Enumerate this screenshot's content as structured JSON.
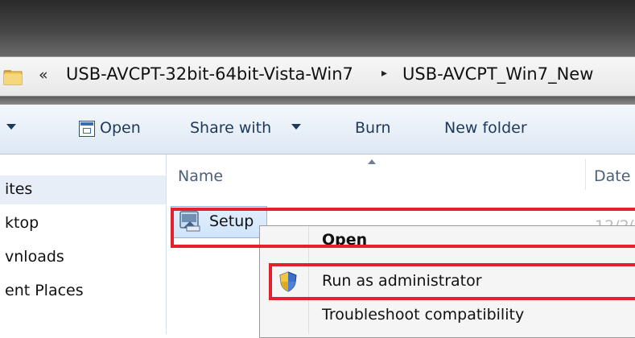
{
  "address": {
    "separator": "«",
    "crumbs": [
      "USB-AVCPT-32bit-64bit-Vista-Win7",
      "USB-AVCPT_Win7_New"
    ],
    "arrow": "▸"
  },
  "toolbar": {
    "open_label": "Open",
    "share_label": "Share with",
    "burn_label": "Burn",
    "new_folder_label": "New folder"
  },
  "nav": {
    "items": [
      "ites",
      "ktop",
      "vnloads",
      "ent Places"
    ]
  },
  "columns": {
    "name": "Name",
    "date": "Date"
  },
  "file": {
    "name": "Setup",
    "date": "12/2("
  },
  "context_menu": {
    "items": [
      "Open",
      "Run as administrator",
      "Troubleshoot compatibility"
    ]
  },
  "colors": {
    "highlight": "#e2212d",
    "toolbar_text": "#1e395b"
  }
}
